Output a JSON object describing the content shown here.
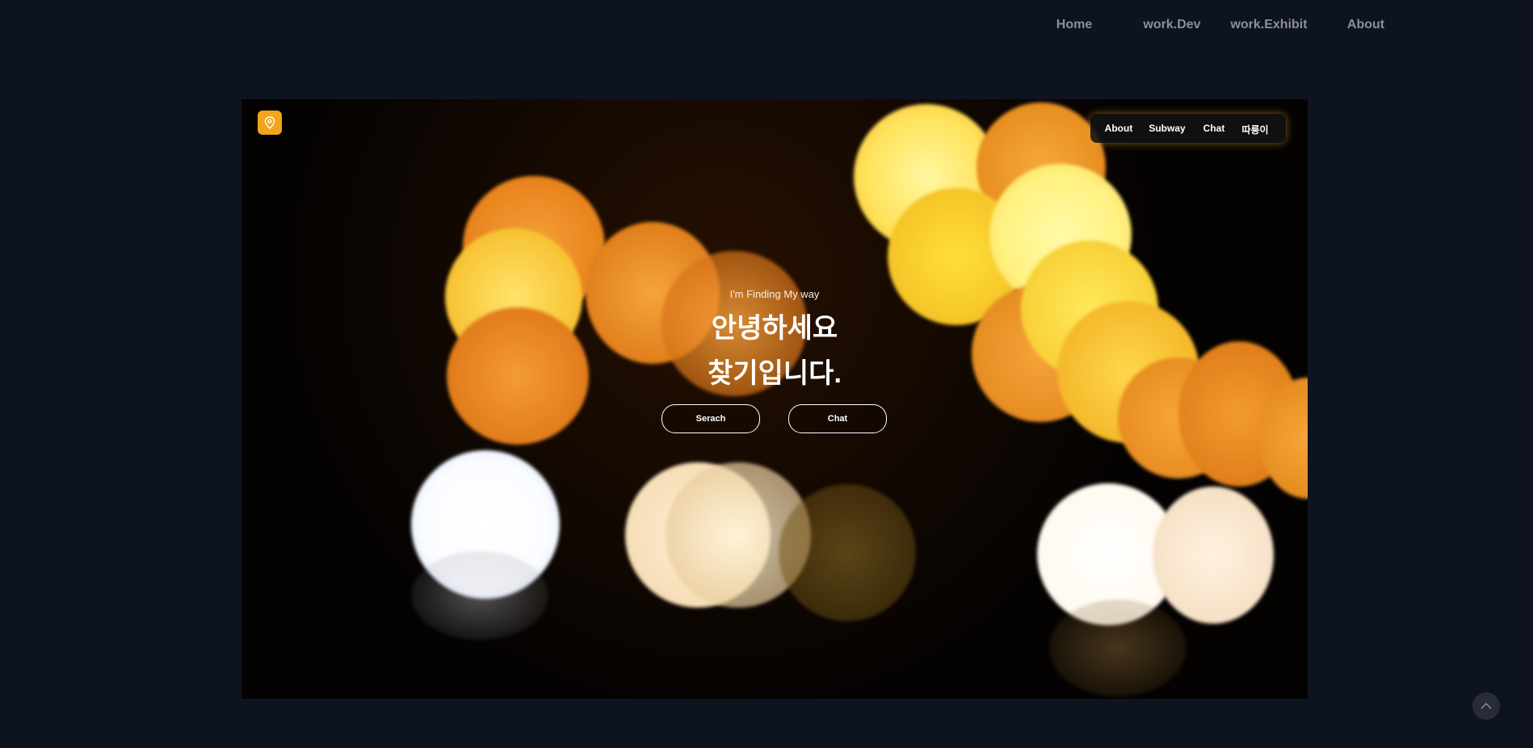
{
  "topnav": {
    "items": [
      {
        "label": "Home"
      },
      {
        "label": "work.Dev"
      },
      {
        "label": "work.Exhibit"
      },
      {
        "label": "About"
      }
    ]
  },
  "hero": {
    "logo_icon": "map-pin-icon",
    "nav": [
      {
        "label": "About"
      },
      {
        "label": "Subway"
      },
      {
        "label": "Chat"
      },
      {
        "label": "따릉이"
      }
    ],
    "tagline": "I'm Finding My way",
    "headline_line1": "안녕하세요",
    "headline_line2": "찾기입니다.",
    "search_button": "Serach",
    "chat_button": "Chat"
  },
  "scroll_top_icon": "chevron-up-icon",
  "colors": {
    "page_background": "#0e1320",
    "accent": "#f3a41c",
    "nav_text": "#8b8f99"
  }
}
